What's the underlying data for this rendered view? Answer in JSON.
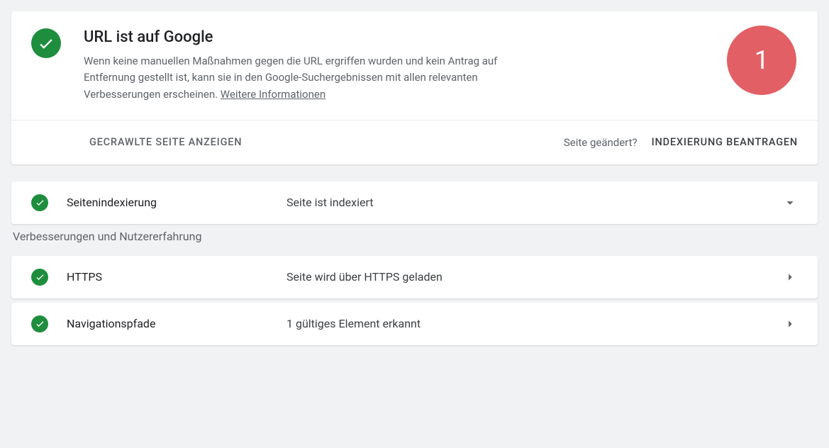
{
  "main": {
    "title": "URL ist auf Google",
    "description_pre": "Wenn keine manuellen Maßnahmen gegen die URL ergriffen wurden und kein Antrag auf Entfernung gestellt ist, kann sie in den Google-Suchergebnissen mit allen relevanten Verbesserungen erscheinen. ",
    "learn_more": "Weitere Informationen",
    "annotation_badge": "1",
    "footer": {
      "view_crawled": "GECRAWLTE SEITE ANZEIGEN",
      "page_changed": "Seite geändert?",
      "request_indexing": "INDEXIERUNG BEANTRAGEN"
    }
  },
  "indexing_row": {
    "label": "Seitenindexierung",
    "status": "Seite ist indexiert"
  },
  "section_label": "Verbesserungen und Nutzererfahrung",
  "rows": [
    {
      "label": "HTTPS",
      "status": "Seite wird über HTTPS geladen"
    },
    {
      "label": "Navigationspfade",
      "status": "1 gültiges Element erkannt"
    }
  ]
}
